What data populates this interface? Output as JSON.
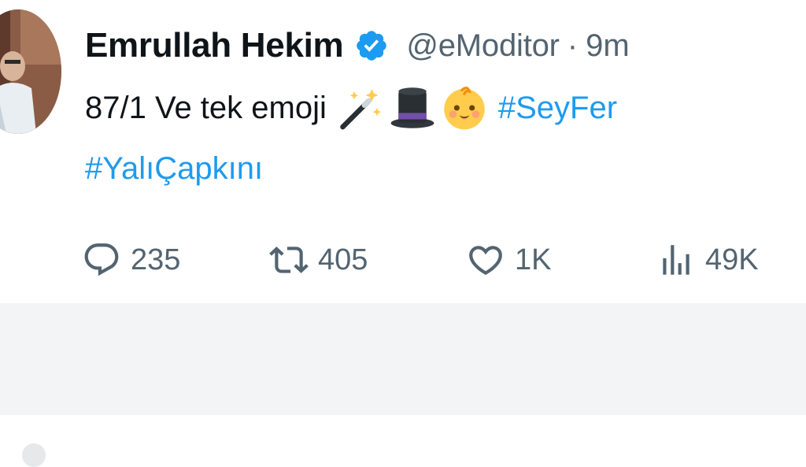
{
  "tweet": {
    "author": {
      "display_name": "Emrullah Hekim",
      "handle": "@eModitor",
      "verified": true
    },
    "separator": "·",
    "time": "9m",
    "text": "87/1 Ve tek emoji",
    "emojis": [
      "magic-wand-emoji",
      "top-hat-emoji",
      "baby-face-emoji"
    ],
    "hashtags": [
      "#SeyFer",
      "#YalıÇapkını"
    ],
    "actions": {
      "reply_count": "235",
      "repost_count": "405",
      "like_count": "1K",
      "views_count": "49K"
    }
  },
  "colors": {
    "text_primary": "#0f1419",
    "text_secondary": "#536471",
    "accent": "#1d9bf0",
    "divider": "#f3f4f6"
  }
}
